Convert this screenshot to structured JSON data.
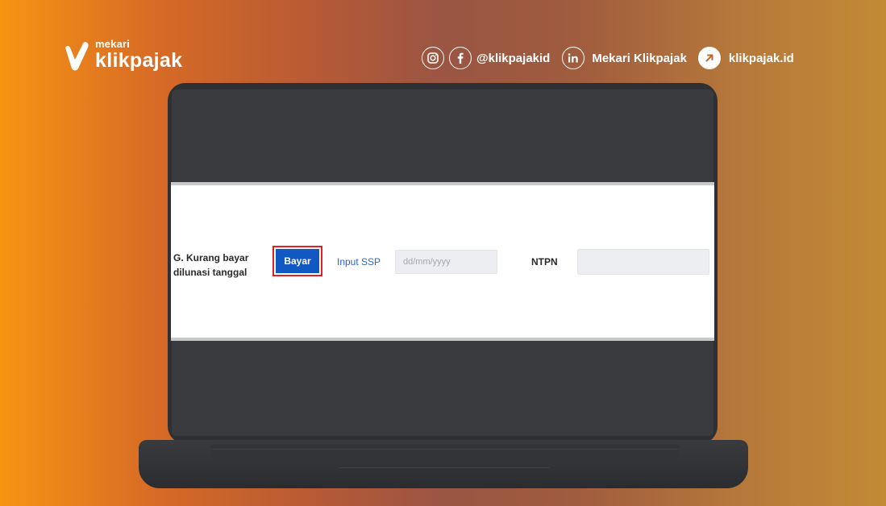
{
  "brand": {
    "top": "mekari",
    "name": "klikpajak"
  },
  "socials": {
    "instagram_icon": "instagram-icon",
    "facebook_icon": "facebook-icon",
    "handle": "@klikpajakid",
    "linkedin_icon": "linkedin-icon",
    "linkedin_name": "Mekari Klikpajak",
    "website_icon": "arrow-up-right-icon",
    "website": "klikpajak.id"
  },
  "form": {
    "label": "G. Kurang bayar dilunasi tanggal",
    "pay_button": "Bayar",
    "input_ssp_link": "Input SSP",
    "date_placeholder": "dd/mm/yyyy",
    "ntpn_label": "NTPN",
    "ntpn_value": ""
  },
  "colors": {
    "pay_button": "#1158c3",
    "highlight": "#e21f26",
    "link": "#2e63c9",
    "gradient_left": "#f79413",
    "gradient_right": "#c28a35"
  }
}
